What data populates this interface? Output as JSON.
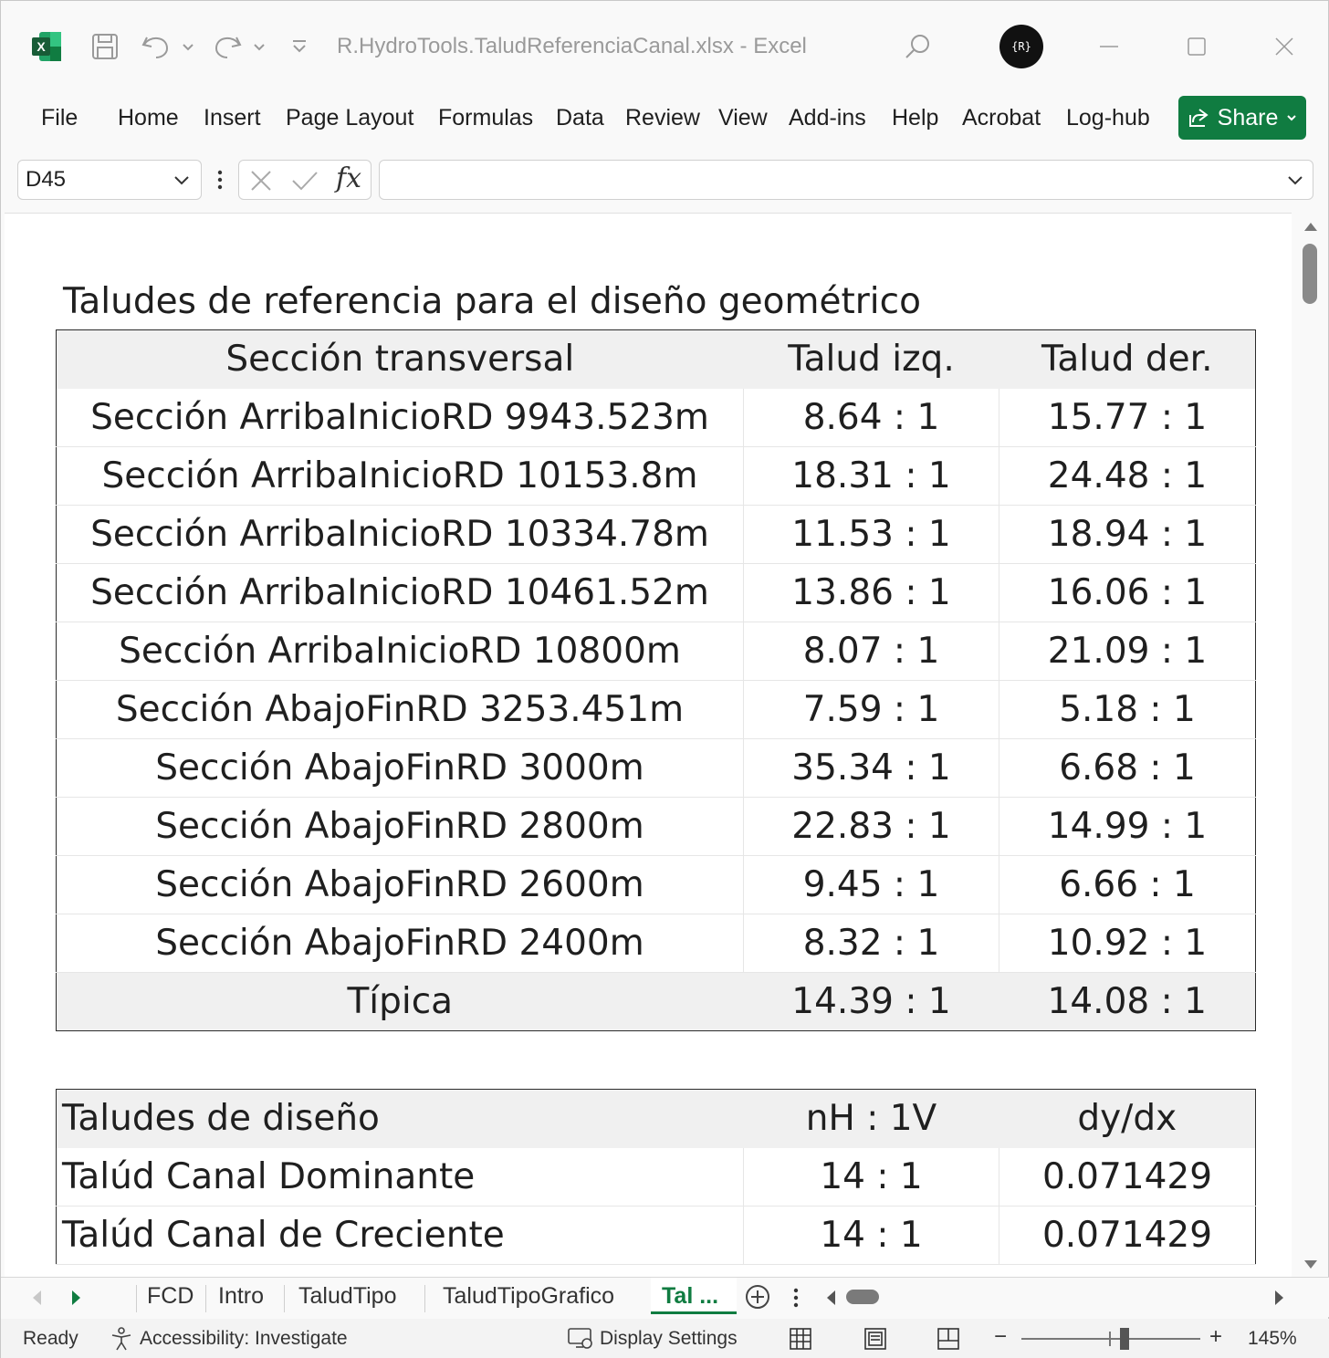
{
  "app": {
    "title": "R.HydroTools.TaludReferenciaCanal.xlsx  -  Excel",
    "avatar_initials": "{R}",
    "share_label": "Share"
  },
  "ribbon": {
    "tabs": [
      "File",
      "Home",
      "Insert",
      "Page Layout",
      "Formulas",
      "Data",
      "Review",
      "View",
      "Add-ins",
      "Help",
      "Acrobat",
      "Log-hub"
    ]
  },
  "formula_bar": {
    "name_box": "D45",
    "fx_label": "fx",
    "value": ""
  },
  "sheet": {
    "title": "Taludes de referencia para el diseño geométrico",
    "ref_table": {
      "headers": [
        "Sección transversal",
        "Talud izq.",
        "Talud der."
      ],
      "rows": [
        [
          "Sección ArribaInicioRD 9943.523m",
          "8.64 : 1",
          "15.77 : 1"
        ],
        [
          "Sección ArribaInicioRD 10153.8m",
          "18.31 : 1",
          "24.48 : 1"
        ],
        [
          "Sección ArribaInicioRD 10334.78m",
          "11.53 : 1",
          "18.94 : 1"
        ],
        [
          "Sección ArribaInicioRD 10461.52m",
          "13.86 : 1",
          "16.06 : 1"
        ],
        [
          "Sección ArribaInicioRD 10800m",
          "8.07 : 1",
          "21.09 : 1"
        ],
        [
          "Sección AbajoFinRD 3253.451m",
          "7.59 : 1",
          "5.18 : 1"
        ],
        [
          "Sección AbajoFinRD 3000m",
          "35.34 : 1",
          "6.68 : 1"
        ],
        [
          "Sección AbajoFinRD 2800m",
          "22.83 : 1",
          "14.99 : 1"
        ],
        [
          "Sección AbajoFinRD 2600m",
          "9.45 : 1",
          "6.66 : 1"
        ],
        [
          "Sección AbajoFinRD 2400m",
          "8.32 : 1",
          "10.92 : 1"
        ]
      ],
      "footer": [
        "Típica",
        "14.39 : 1",
        "14.08 : 1"
      ]
    },
    "design_table": {
      "headers": [
        "Taludes de diseño",
        "nH : 1V",
        "dy/dx"
      ],
      "rows": [
        [
          "Talúd Canal Dominante",
          "14 : 1",
          "0.071429"
        ],
        [
          "Talúd Canal de Creciente",
          "14 : 1",
          "0.071429"
        ]
      ],
      "value_color": "#2e75b6"
    }
  },
  "sheet_tabs": {
    "tabs": [
      "FCD",
      "Intro",
      "TaludTipo",
      "TaludTipoGrafico"
    ],
    "active_tab": "Tal ...",
    "accent": "#107c41"
  },
  "status": {
    "ready": "Ready",
    "accessibility": "Accessibility: Investigate",
    "display_settings": "Display Settings",
    "zoom": "145%"
  }
}
